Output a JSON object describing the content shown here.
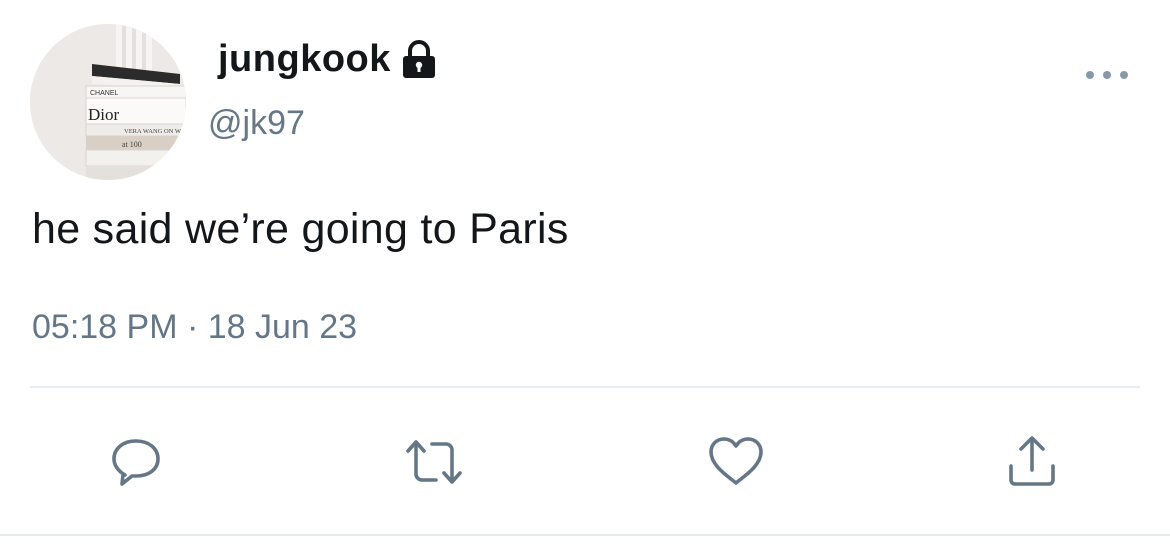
{
  "tweet": {
    "display_name": "jungkook",
    "handle": "@jk97",
    "text": "he said we’re going to Paris",
    "timestamp": "05:18 PM · 18 Jun 23"
  },
  "avatar": {
    "book_spines": [
      "CHANEL",
      "Dior",
      "VERA WANG ON W",
      "at 100"
    ]
  },
  "icons": {
    "verified_lock": "lock-icon",
    "more": "more-icon",
    "reply": "reply-icon",
    "retweet": "retweet-icon",
    "like": "heart-icon",
    "share": "share-icon"
  },
  "colors": {
    "text": "#14171a",
    "secondary": "#657786",
    "divider": "#e6ecf0"
  }
}
